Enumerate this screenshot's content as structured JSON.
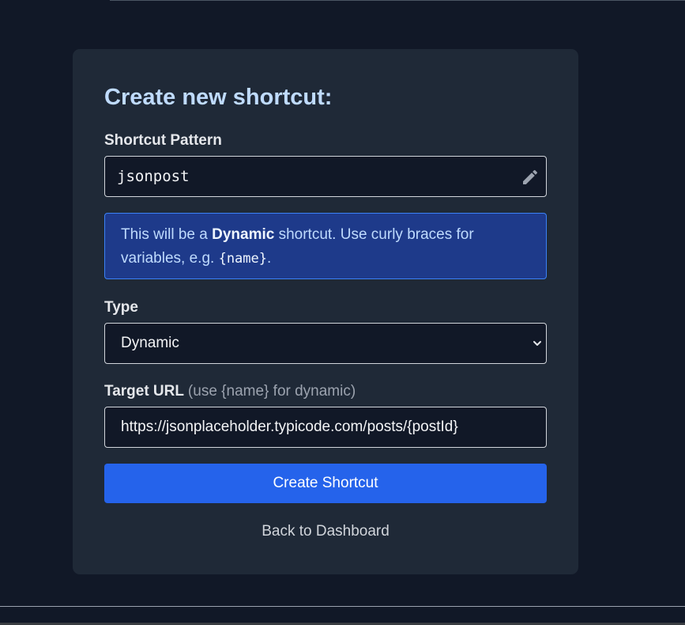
{
  "form": {
    "title": "Create new shortcut:",
    "pattern_label": "Shortcut Pattern",
    "pattern_value": "jsonpost",
    "info": {
      "prefix": "This will be a ",
      "emphasis": "Dynamic",
      "suffix": " shortcut. Use curly braces for variables, e.g. ",
      "example": "{name}",
      "end": "."
    },
    "type_label": "Type",
    "type_value": "Dynamic",
    "url_label": "Target URL",
    "url_hint": "(use {name} for dynamic)",
    "url_value": "https://jsonplaceholder.typicode.com/posts/{postId}",
    "submit_label": "Create Shortcut",
    "back_label": "Back to Dashboard"
  },
  "icons": {
    "pattern_field": "pencil-icon",
    "type_select": "chevron-down-icon"
  },
  "colors": {
    "page_background": "#111827",
    "card_background": "#1f2937",
    "title": "#bfdbfe",
    "info_background": "#1e3a8a",
    "info_border": "#3b82f6",
    "primary_button": "#2563eb"
  }
}
